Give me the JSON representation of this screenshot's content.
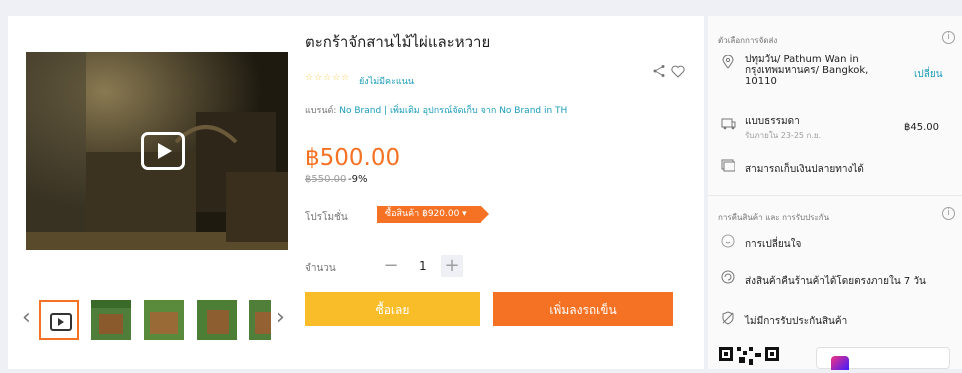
{
  "product": {
    "title": "ตะกร้าจักสานไม้ไผ่และหวาย",
    "stars": "☆☆☆☆☆",
    "no_rating": "ยังไม่มีคะแนน",
    "brand_label": "แบรนด์:",
    "brand_name": "No Brand",
    "brand_more": "| เพิ่มเติม อุปกรณ์จัดเก็บ จาก No Brand in TH",
    "price": "฿500.00",
    "original_price": "฿550.00",
    "discount": "-9%",
    "promo_label": "โปรโมชั่น",
    "promo_badge": "ซื้อสินค้า ฿920.00 ▾",
    "qty_label": "จำนวน",
    "qty_value": "1",
    "qty_minus": "−",
    "qty_plus": "+",
    "buy_now": "ซื้อเลย",
    "add_to_cart": "เพิ่มลงรถเข็น"
  },
  "gallery": {
    "prev": "‹",
    "next": "›"
  },
  "delivery": {
    "section_title": "ตัวเลือกการจัดส่ง",
    "info": "i",
    "location": "ปทุมวัน/ Pathum Wan in กรุงเทพมหานคร/ Bangkok, 10110",
    "change": "เปลี่ยน",
    "standard": "แบบธรรมดา",
    "standard_eta": "รับภายใน 23-25 ก.ย.",
    "standard_price": "฿45.00",
    "cod": "สามารถเก็บเงินปลายทางได้"
  },
  "returns": {
    "section_title": "การคืนสินค้า และ การรับประกัน",
    "info": "i",
    "change_mind": "การเปลี่ยนใจ",
    "return_7": "ส่งสินค้าคืนร้านค้าได้โดยตรงภายใน 7 วัน",
    "no_warranty": "ไม่มีการรับประกันสินค้า"
  },
  "colors": {
    "accent": "#f57224",
    "buy": "#fabd2a",
    "link": "#1a9cb7"
  },
  "icons": [
    "play-icon",
    "share-icon",
    "heart-icon",
    "location-icon",
    "truck-icon",
    "cash-icon",
    "change-mind-icon",
    "return-icon",
    "no-warranty-icon",
    "qr-code",
    "lazada-app-logo"
  ]
}
